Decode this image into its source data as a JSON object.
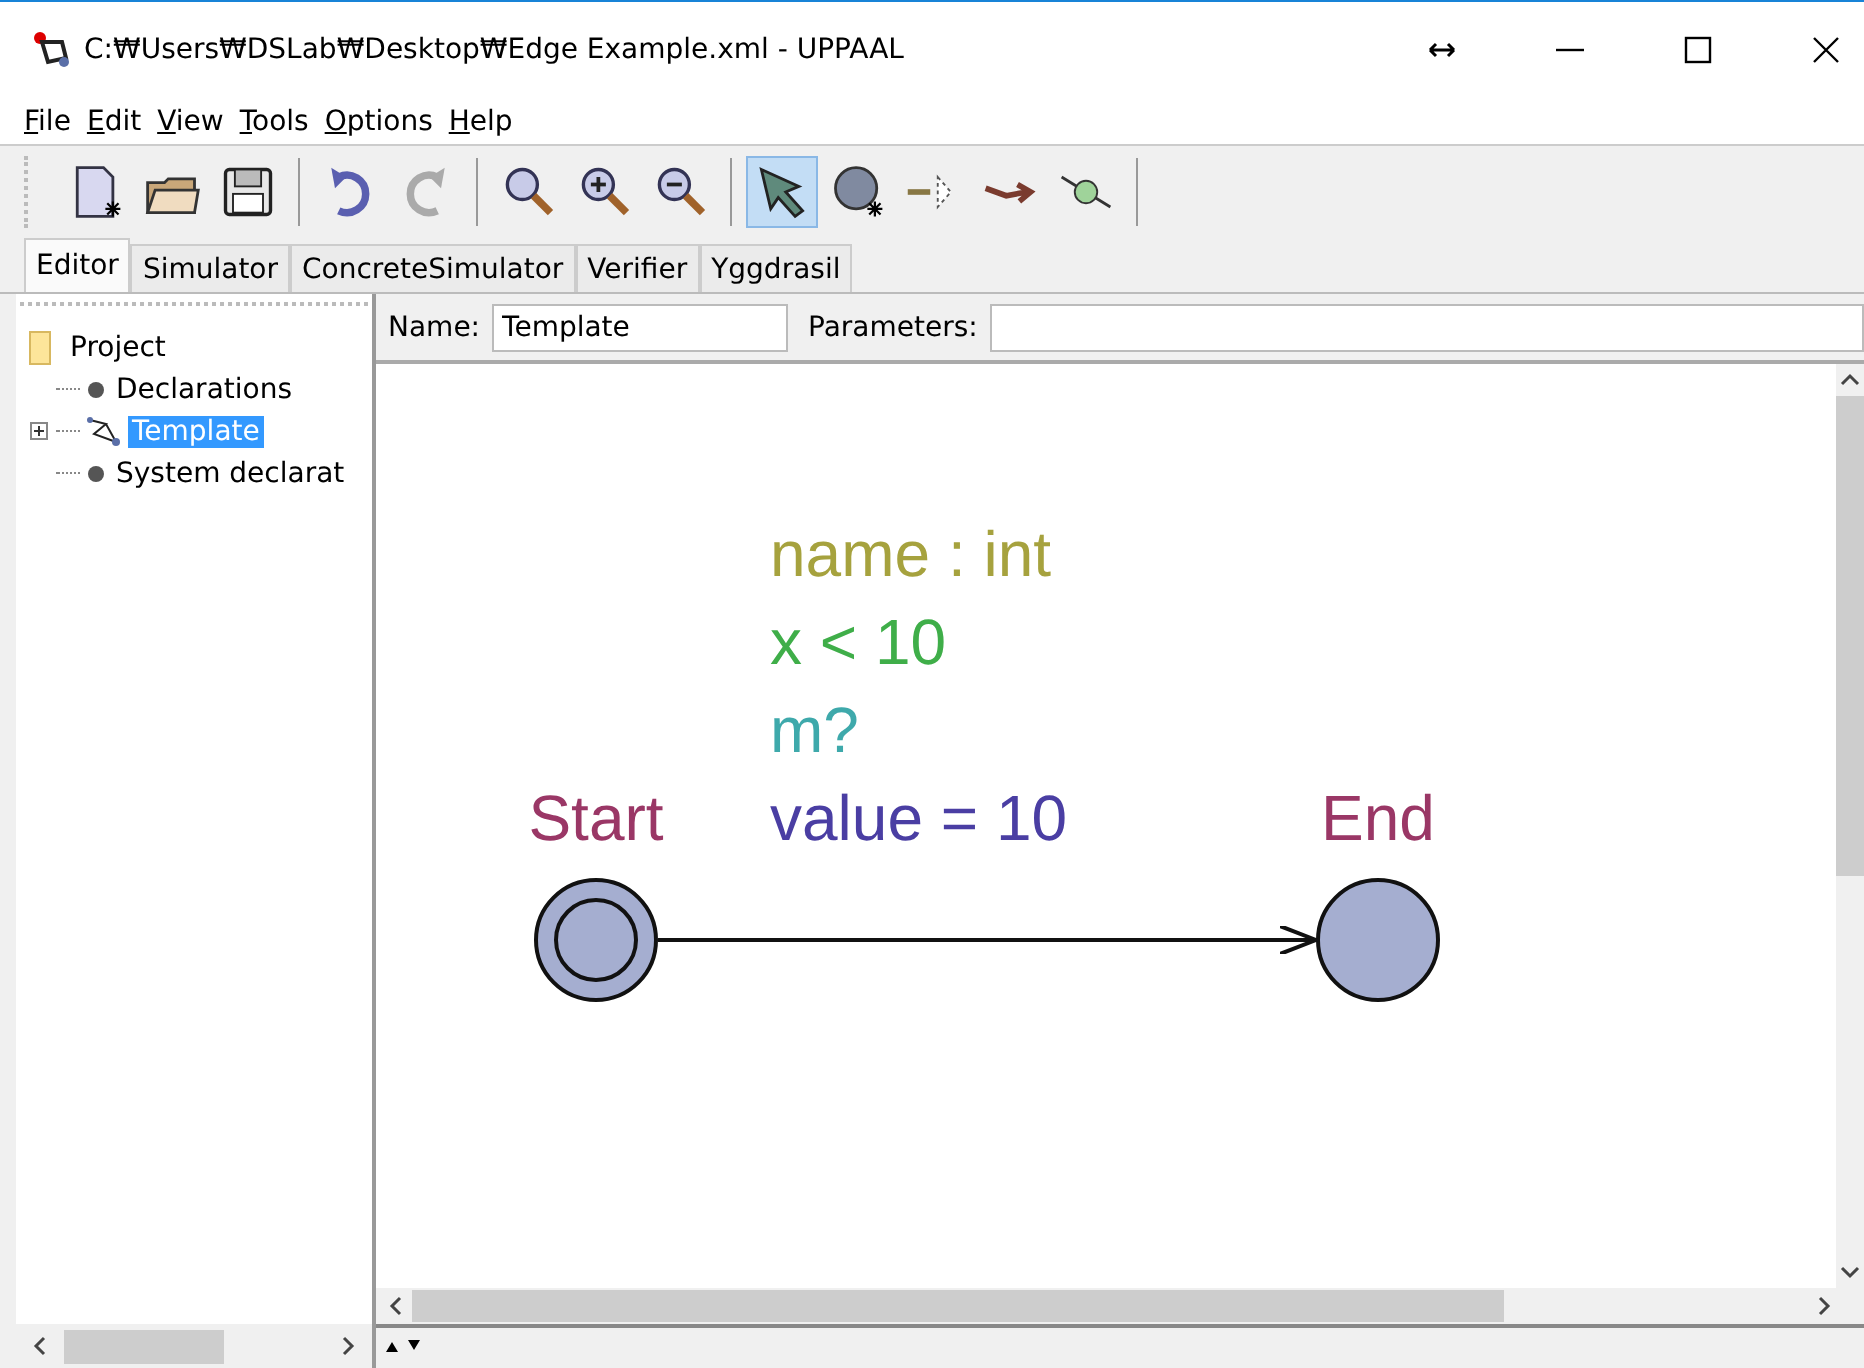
{
  "window": {
    "title": "C:₩Users₩DSLab₩Desktop₩Edge Example.xml - UPPAAL"
  },
  "menu": [
    {
      "label": "File"
    },
    {
      "label": "Edit"
    },
    {
      "label": "View"
    },
    {
      "label": "Tools"
    },
    {
      "label": "Options"
    },
    {
      "label": "Help"
    }
  ],
  "toolbar": [
    {
      "kind": "new",
      "selected": false,
      "disabled": false
    },
    {
      "kind": "open",
      "selected": false,
      "disabled": false
    },
    {
      "kind": "save",
      "selected": false,
      "disabled": false
    },
    {
      "kind": "sep"
    },
    {
      "kind": "undo",
      "selected": false,
      "disabled": false
    },
    {
      "kind": "redo",
      "selected": false,
      "disabled": true
    },
    {
      "kind": "sep"
    },
    {
      "kind": "zoom",
      "selected": false,
      "disabled": false
    },
    {
      "kind": "zoomin",
      "selected": false,
      "disabled": false
    },
    {
      "kind": "zoomout",
      "selected": false,
      "disabled": false
    },
    {
      "kind": "sep"
    },
    {
      "kind": "select",
      "selected": true,
      "disabled": false
    },
    {
      "kind": "location",
      "selected": false,
      "disabled": false
    },
    {
      "kind": "branch",
      "selected": false,
      "disabled": false
    },
    {
      "kind": "edge",
      "selected": false,
      "disabled": false
    },
    {
      "kind": "nail",
      "selected": false,
      "disabled": false
    },
    {
      "kind": "sep"
    }
  ],
  "tabs": [
    {
      "label": "Editor",
      "selected": true
    },
    {
      "label": "Simulator",
      "selected": false
    },
    {
      "label": "ConcreteSimulator",
      "selected": false
    },
    {
      "label": "Verifier",
      "selected": false
    },
    {
      "label": "Yggdrasil",
      "selected": false
    }
  ],
  "tree": {
    "label": "Project",
    "children": [
      {
        "label": "Declarations",
        "kind": "decl",
        "selected": false
      },
      {
        "label": "Template",
        "kind": "template",
        "selected": true,
        "expanded": false
      },
      {
        "label": "System declarat",
        "kind": "decl",
        "selected": false
      }
    ]
  },
  "template": {
    "name_label": "Name:",
    "name": "Template",
    "parameters_label": "Parameters:"
  },
  "canvas": {
    "locations": [
      {
        "name": "Start",
        "initial": true
      },
      {
        "name": "End",
        "initial": false
      }
    ],
    "edge_labels": [
      {
        "kind": "select",
        "text": "name : int"
      },
      {
        "kind": "guard",
        "text": "x < 10"
      },
      {
        "kind": "sync",
        "text": "m?"
      },
      {
        "kind": "update",
        "text": "value = 10"
      }
    ]
  }
}
